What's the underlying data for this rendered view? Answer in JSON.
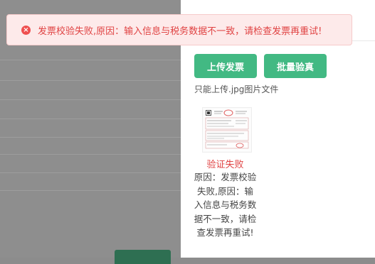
{
  "toast": {
    "message": "发票校验失败,原因：输入信息与税务数据不一致，请检查发票再重试!",
    "icon": "error-circle-icon"
  },
  "drawer": {
    "upload_label": "上传发票",
    "batch_verify_label": "批量验真",
    "hint": "只能上传.jpg图片文件",
    "file": {
      "status": "验证失败",
      "reason": "原因：发票校验失败,原因：输入信息与税务数据不一致，请检查发票再重试!"
    }
  },
  "colors": {
    "accent": "#42b983",
    "error": "#e04343",
    "overlay": "#8e8e8e"
  }
}
